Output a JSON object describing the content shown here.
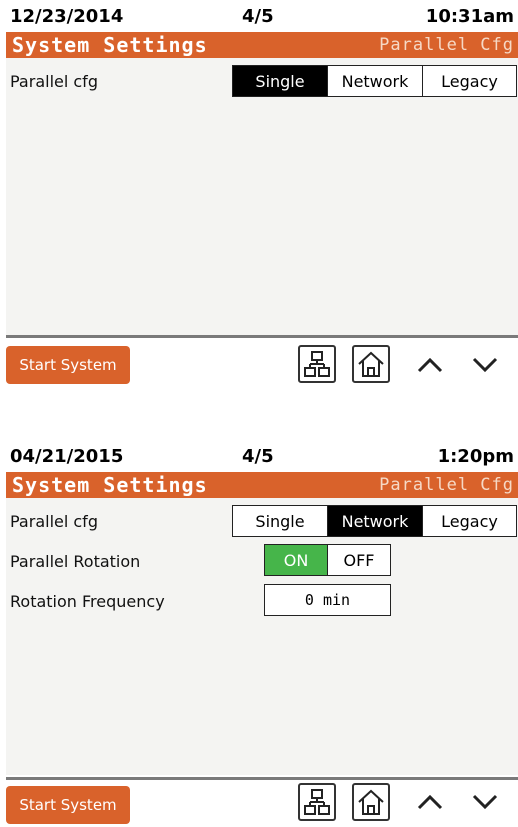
{
  "screens": [
    {
      "status": {
        "date": "12/23/2014",
        "page": "4/5",
        "time": "10:31am"
      },
      "title": {
        "left": "System Settings",
        "right": "Parallel Cfg"
      },
      "rows": {
        "parallel_cfg": {
          "label": "Parallel cfg",
          "options": [
            "Single",
            "Network",
            "Legacy"
          ],
          "selected": "Single"
        }
      },
      "footer": {
        "start_label": "Start System"
      }
    },
    {
      "status": {
        "date": "04/21/2015",
        "page": "4/5",
        "time": "1:20pm"
      },
      "title": {
        "left": "System Settings",
        "right": "Parallel Cfg"
      },
      "rows": {
        "parallel_cfg": {
          "label": "Parallel cfg",
          "options": [
            "Single",
            "Network",
            "Legacy"
          ],
          "selected": "Network"
        },
        "parallel_rotation": {
          "label": "Parallel Rotation",
          "options": [
            "ON",
            "OFF"
          ],
          "selected": "ON"
        },
        "rotation_frequency": {
          "label": "Rotation Frequency",
          "value": "0 min"
        }
      },
      "footer": {
        "start_label": "Start System"
      }
    }
  ],
  "icons": [
    "network-icon",
    "home-icon",
    "chevron-up-icon",
    "chevron-down-icon"
  ],
  "colors": {
    "accent": "#d9622b",
    "on_green": "#46b54a",
    "selected_black": "#000000"
  }
}
